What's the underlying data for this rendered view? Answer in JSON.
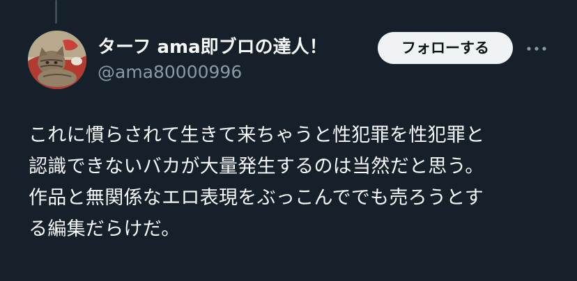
{
  "tweet": {
    "author": {
      "display_name": "ターフ ama即ブロの達人！",
      "handle": "@ama80000996",
      "avatar_icon": "cat-avatar"
    },
    "follow_label": "フォローする",
    "more_icon": "more-dots-icon",
    "text": "これに慣らされて生きて来ちゃうと性犯罪を性犯罪と\n認識できないバカが大量発生するのは当然だと思う。\n作品と無関係なエロ表現をぶっこんででも売ろうとす\nる編集だらけだ。"
  },
  "colors": {
    "background": "#15202b",
    "primary_text": "#f7f9f9",
    "secondary_text": "#8b98a5",
    "button_bg": "#eff3f4",
    "button_text": "#0f1419"
  }
}
